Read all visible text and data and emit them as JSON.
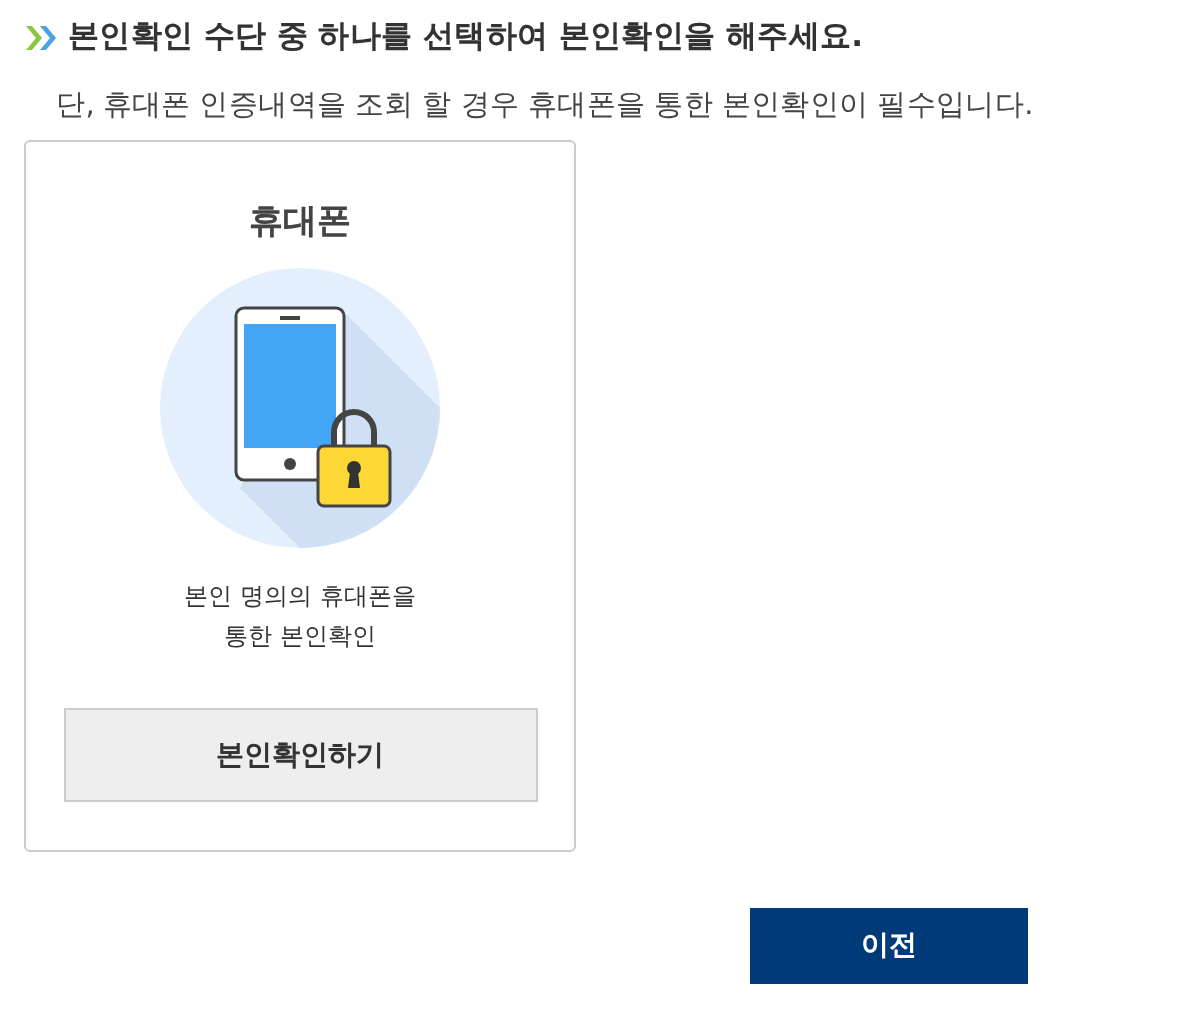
{
  "heading": "본인확인 수단 중 하나를 선택하여 본인확인을 해주세요.",
  "notice": "단, 휴대폰 인증내역을 조회 할 경우 휴대폰을 통한 본인확인이 필수입니다.",
  "methods": [
    {
      "title": "휴대폰",
      "description": [
        "본인 명의의 휴대폰을",
        "통한 본인확인"
      ],
      "button": "본인확인하기"
    }
  ],
  "prev_button": "이전"
}
